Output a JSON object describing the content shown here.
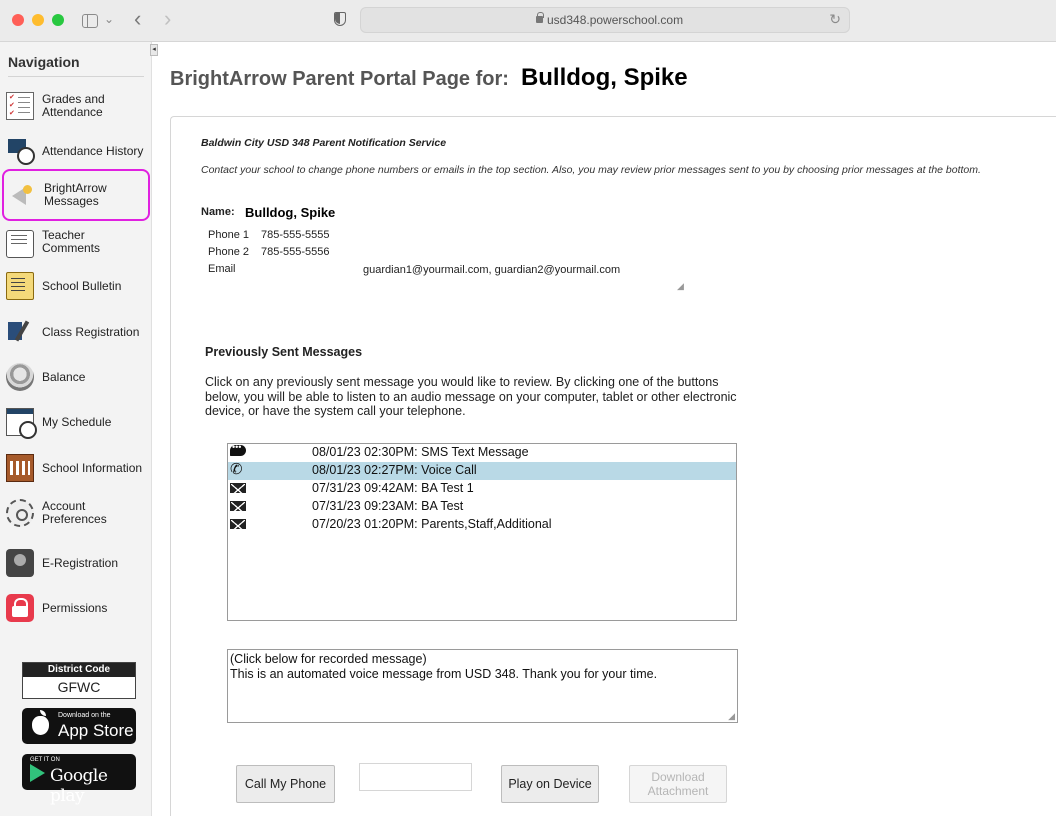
{
  "browser": {
    "url": "usd348.powerschool.com"
  },
  "nav": {
    "title": "Navigation",
    "items": [
      {
        "label": "Grades and Attendance",
        "icon": "grades-icon"
      },
      {
        "label": "Attendance History",
        "icon": "attendance-icon"
      },
      {
        "label": "BrightArrow Messages",
        "icon": "brightarrow-icon",
        "active": true
      },
      {
        "label": "Teacher Comments",
        "icon": "comments-icon"
      },
      {
        "label": "School Bulletin",
        "icon": "bulletin-icon"
      },
      {
        "label": "Class Registration",
        "icon": "class-registration-icon"
      },
      {
        "label": "Balance",
        "icon": "balance-icon"
      },
      {
        "label": "My Schedule",
        "icon": "schedule-icon"
      },
      {
        "label": "School Information",
        "icon": "school-icon"
      },
      {
        "label": "Account Preferences",
        "icon": "account-icon"
      },
      {
        "label": "E-Registration",
        "icon": "e-registration-icon"
      },
      {
        "label": "Permissions",
        "icon": "lock-icon"
      }
    ],
    "district": {
      "label": "District Code",
      "code": "GFWC"
    },
    "app_store": {
      "small": "Download on the",
      "big": "App Store"
    },
    "google_play": {
      "small": "GET IT ON",
      "big": "Google play"
    }
  },
  "page": {
    "heading_label": "BrightArrow Parent Portal Page for:",
    "student_name": "Bulldog, Spike",
    "service_title": "Baldwin City USD 348 Parent Notification Service",
    "service_desc": "Contact your school to change phone numbers or emails in the top section. Also, you may review prior messages sent to you by choosing prior messages at the bottom.",
    "name_label": "Name:",
    "name_value": "Bulldog, Spike",
    "phone1_label": "Phone 1",
    "phone1_value": "785-555-5555",
    "phone2_label": "Phone 2",
    "phone2_value": "785-555-5556",
    "email_label": "Email",
    "email_value": "guardian1@yourmail.com, guardian2@yourmail.com",
    "prev_title": "Previously Sent Messages",
    "prev_desc": "Click on any previously sent message you would like to review. By clicking one of the buttons below, you will be able to listen to an audio message on your computer, tablet or other electronic device, or have the system call your telephone.",
    "messages": [
      {
        "text": "08/01/23 02:30PM: SMS Text Message",
        "icon": "sms-icon"
      },
      {
        "text": "08/01/23 02:27PM: Voice Call",
        "icon": "phone-icon",
        "selected": true
      },
      {
        "text": "07/31/23 09:42AM: BA Test 1",
        "icon": "envelope-icon"
      },
      {
        "text": "07/31/23 09:23AM: BA Test",
        "icon": "envelope-icon"
      },
      {
        "text": "07/20/23 01:20PM: Parents,Staff,Additional",
        "icon": "envelope-icon"
      }
    ],
    "recorded_hint": "(Click below for recorded message)",
    "recorded_text": "This is an automated voice message from USD 348. Thank you for your time.",
    "buttons": {
      "call": "Call My Phone",
      "play": "Play on Device",
      "download_line1": "Download",
      "download_line2": "Attachment"
    }
  },
  "colors": {
    "active_outline": "#e020e0",
    "selected_row": "#b9d9e6"
  }
}
